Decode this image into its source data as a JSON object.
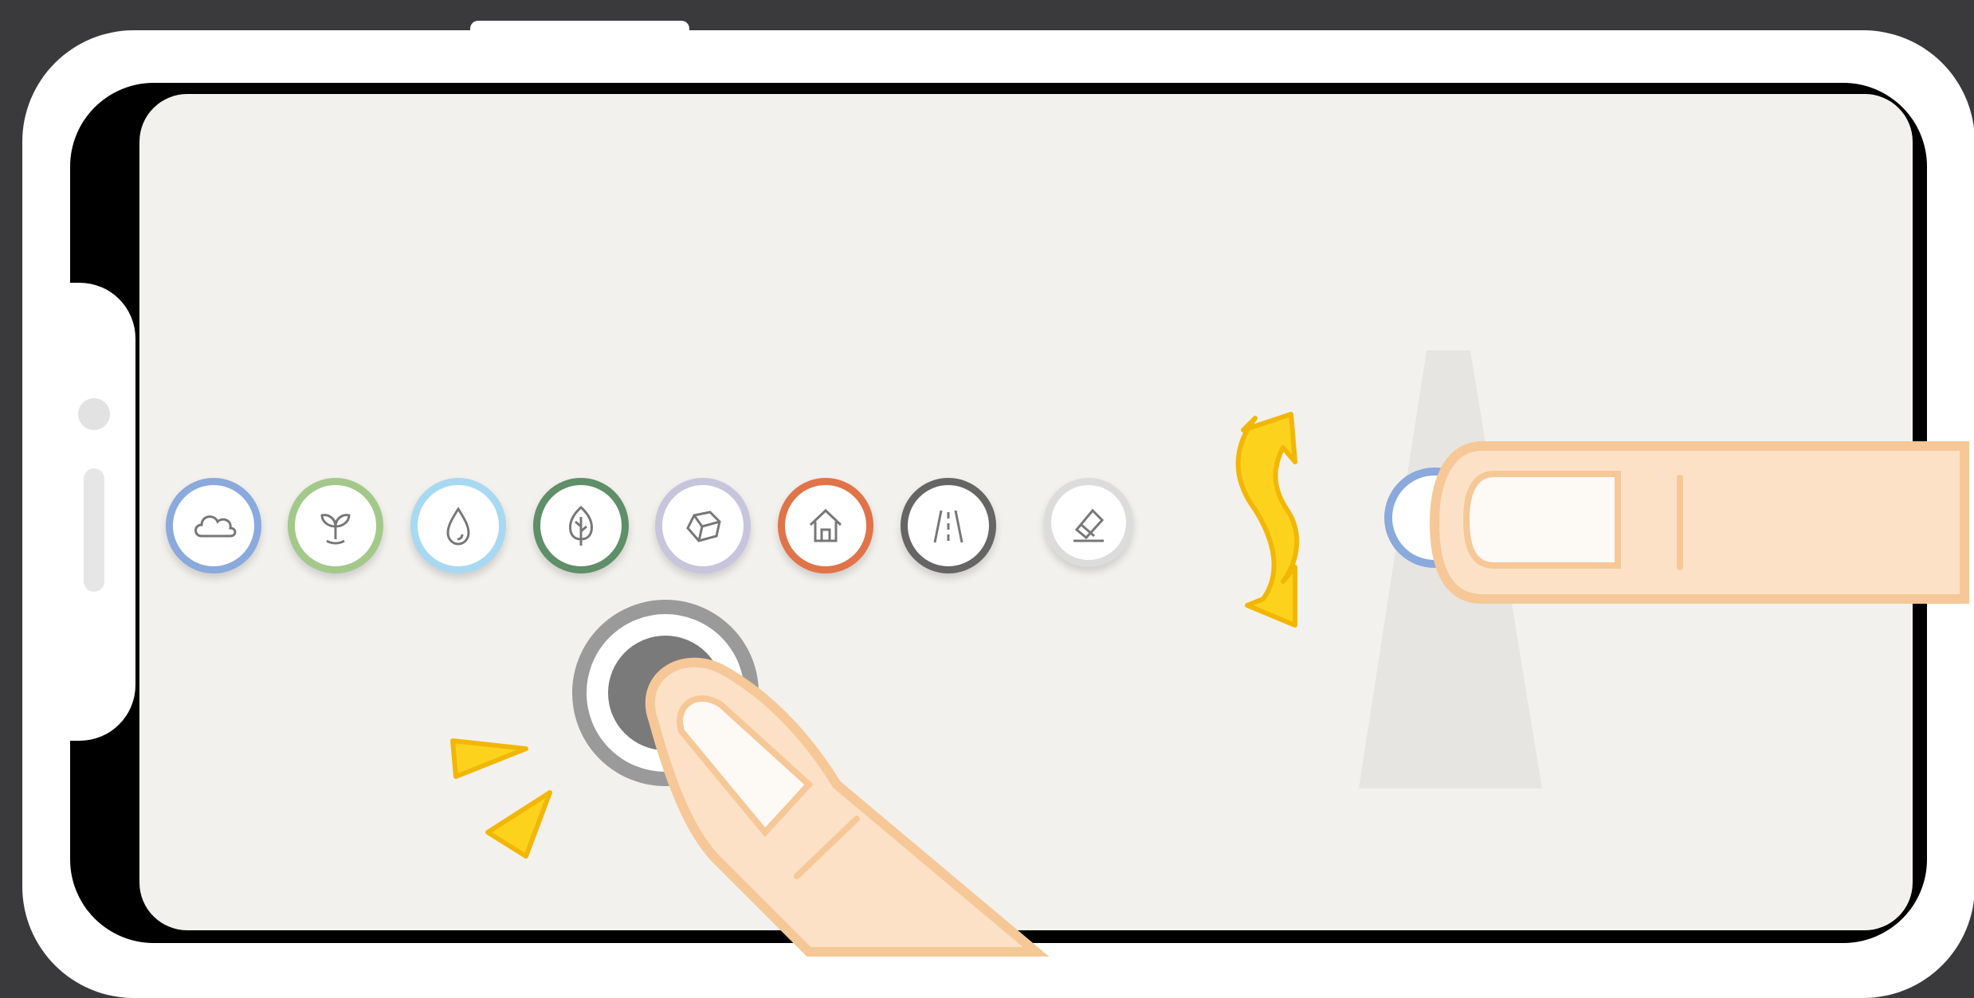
{
  "palette": {
    "background": "#3a3a3d",
    "screen": "#f3f1ed",
    "accent_yellow": "#fcd21d",
    "finger_skin": "#fde1c6",
    "finger_outline": "#f6c897"
  },
  "toolbar": {
    "tools": [
      {
        "name": "cloud-icon",
        "ring_color": "#8aa9dc"
      },
      {
        "name": "sprout-icon",
        "ring_color": "#a3c98a"
      },
      {
        "name": "water-drop-icon",
        "ring_color": "#a8d9f2"
      },
      {
        "name": "tree-icon",
        "ring_color": "#5e8f68"
      },
      {
        "name": "rock-icon",
        "ring_color": "#c6c5dc"
      },
      {
        "name": "house-icon",
        "ring_color": "#e07448"
      },
      {
        "name": "road-icon",
        "ring_color": "#656565"
      },
      {
        "name": "eraser-icon",
        "ring_color": "#dcdcdc"
      }
    ],
    "selected_tool": {
      "name": "cloud-icon",
      "ring_color": "#8aa9dc"
    }
  },
  "gestures": {
    "tap": {
      "name": "tap-gesture",
      "ring_color": "#9a9a9a",
      "center_color": "#7a7a7a"
    },
    "rotate": {
      "name": "rotate-arrow-icon",
      "color": "#fcd21d"
    }
  }
}
